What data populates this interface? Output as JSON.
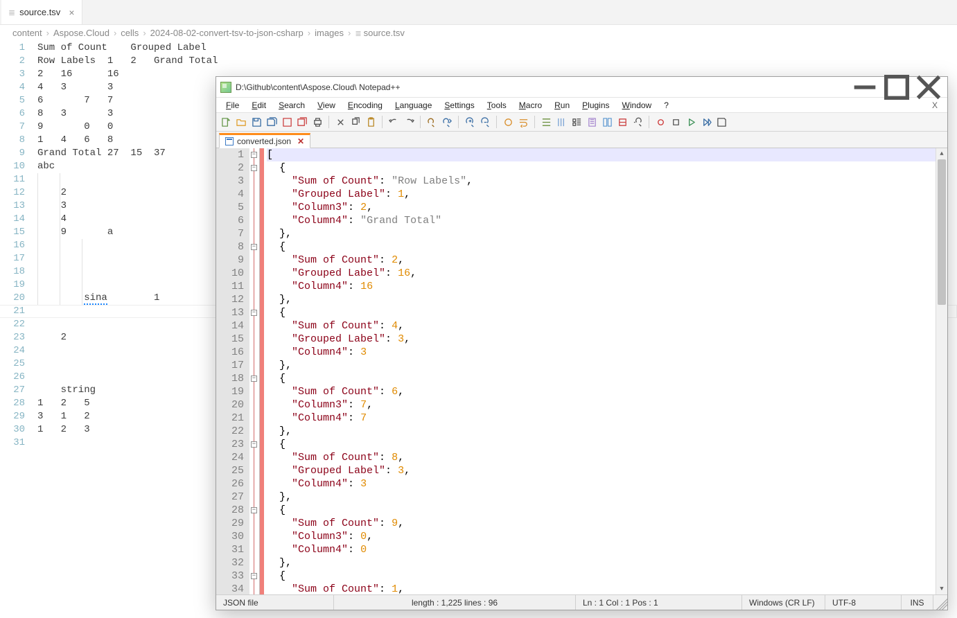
{
  "vscode": {
    "tab": {
      "label": "source.tsv",
      "icon": "lines-icon"
    },
    "breadcrumb": [
      "content",
      "Aspose.Cloud",
      "cells",
      "2024-08-02-convert-tsv-to-json-csharp",
      "images",
      "source.tsv"
    ],
    "lines": [
      "Sum of Count    Grouped Label",
      "Row Labels  1   2   Grand Total",
      "2   16      16",
      "4   3       3",
      "6       7   7",
      "8   3       3",
      "9       0   0",
      "1   4   6   8",
      "Grand Total 27  15  37",
      "abc",
      "",
      "    2",
      "    3",
      "    4",
      "    9       a",
      "",
      "",
      "",
      "",
      "        sina        1",
      "",
      "",
      "    2",
      "",
      "",
      "",
      "    string",
      "1   2   5",
      "3   1   2",
      "1   2   3",
      ""
    ],
    "squiggle_line": 20,
    "squiggle_word": "sina",
    "selected_line": 21
  },
  "npp": {
    "title": "D:\\Github\\content\\Aspose.Cloud\\ Notepad++",
    "menu": [
      "File",
      "Edit",
      "Search",
      "View",
      "Encoding",
      "Language",
      "Settings",
      "Tools",
      "Macro",
      "Run",
      "Plugins",
      "Window",
      "?"
    ],
    "menu_right": "X",
    "tab": {
      "label": "converted.json",
      "close": "✕"
    },
    "code": [
      {
        "n": 1,
        "t": "[",
        "fold": "open"
      },
      {
        "n": 2,
        "t": "  {",
        "fold": "open"
      },
      {
        "n": 3,
        "t": "    \"Sum of Count\": \"Row Labels\","
      },
      {
        "n": 4,
        "t": "    \"Grouped Label\": 1,"
      },
      {
        "n": 5,
        "t": "    \"Column3\": 2,"
      },
      {
        "n": 6,
        "t": "    \"Column4\": \"Grand Total\""
      },
      {
        "n": 7,
        "t": "  },"
      },
      {
        "n": 8,
        "t": "  {",
        "fold": "open"
      },
      {
        "n": 9,
        "t": "    \"Sum of Count\": 2,"
      },
      {
        "n": 10,
        "t": "    \"Grouped Label\": 16,"
      },
      {
        "n": 11,
        "t": "    \"Column4\": 16"
      },
      {
        "n": 12,
        "t": "  },"
      },
      {
        "n": 13,
        "t": "  {",
        "fold": "open"
      },
      {
        "n": 14,
        "t": "    \"Sum of Count\": 4,"
      },
      {
        "n": 15,
        "t": "    \"Grouped Label\": 3,"
      },
      {
        "n": 16,
        "t": "    \"Column4\": 3"
      },
      {
        "n": 17,
        "t": "  },"
      },
      {
        "n": 18,
        "t": "  {",
        "fold": "open"
      },
      {
        "n": 19,
        "t": "    \"Sum of Count\": 6,"
      },
      {
        "n": 20,
        "t": "    \"Column3\": 7,"
      },
      {
        "n": 21,
        "t": "    \"Column4\": 7"
      },
      {
        "n": 22,
        "t": "  },"
      },
      {
        "n": 23,
        "t": "  {",
        "fold": "open"
      },
      {
        "n": 24,
        "t": "    \"Sum of Count\": 8,"
      },
      {
        "n": 25,
        "t": "    \"Grouped Label\": 3,"
      },
      {
        "n": 26,
        "t": "    \"Column4\": 3"
      },
      {
        "n": 27,
        "t": "  },"
      },
      {
        "n": 28,
        "t": "  {",
        "fold": "open"
      },
      {
        "n": 29,
        "t": "    \"Sum of Count\": 9,"
      },
      {
        "n": 30,
        "t": "    \"Column3\": 0,"
      },
      {
        "n": 31,
        "t": "    \"Column4\": 0"
      },
      {
        "n": 32,
        "t": "  },"
      },
      {
        "n": 33,
        "t": "  {",
        "fold": "open"
      },
      {
        "n": 34,
        "t": "    \"Sum of Count\": 1,"
      }
    ],
    "status": {
      "type": "JSON file",
      "length": "length : 1,225    lines : 96",
      "pos": "Ln : 1    Col : 1    Pos : 1",
      "eol": "Windows (CR LF)",
      "enc": "UTF-8",
      "mode": "INS"
    }
  }
}
